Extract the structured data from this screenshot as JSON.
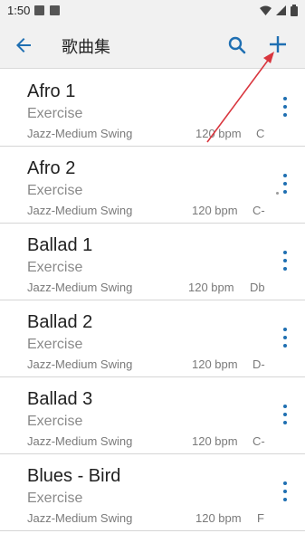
{
  "status_bar": {
    "time": "1:50"
  },
  "app_bar": {
    "title": "歌曲集"
  },
  "colors": {
    "accent": "#1f6fb2",
    "annotation": "#d9363e"
  },
  "songs": [
    {
      "title": "Afro 1",
      "subtitle": "Exercise",
      "style": "Jazz-Medium Swing",
      "tempo": "120 bpm",
      "key": "C"
    },
    {
      "title": "Afro 2",
      "subtitle": "Exercise",
      "style": "Jazz-Medium Swing",
      "tempo": "120 bpm",
      "key": "C-"
    },
    {
      "title": "Ballad 1",
      "subtitle": "Exercise",
      "style": "Jazz-Medium Swing",
      "tempo": "120 bpm",
      "key": "Db"
    },
    {
      "title": "Ballad 2",
      "subtitle": "Exercise",
      "style": "Jazz-Medium Swing",
      "tempo": "120 bpm",
      "key": "D-"
    },
    {
      "title": "Ballad 3",
      "subtitle": "Exercise",
      "style": "Jazz-Medium Swing",
      "tempo": "120 bpm",
      "key": "C-"
    },
    {
      "title": "Blues - Bird",
      "subtitle": "Exercise",
      "style": "Jazz-Medium Swing",
      "tempo": "120 bpm",
      "key": "F"
    }
  ]
}
